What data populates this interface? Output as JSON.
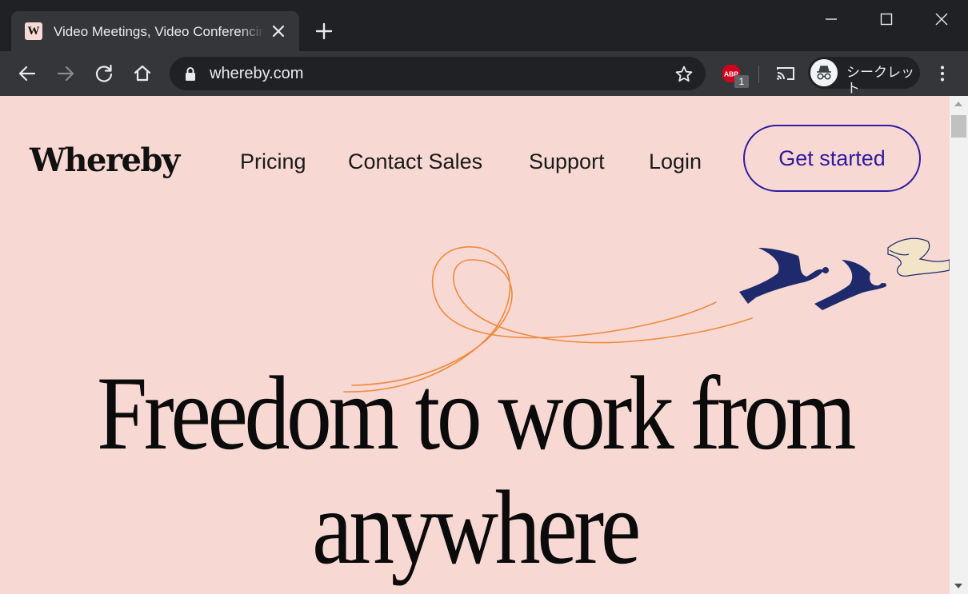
{
  "browser": {
    "tab_title": "Video Meetings, Video Conferencing",
    "tab_favicon_letter": "W",
    "url": "whereby.com",
    "adblock_label": "ABP",
    "adblock_count": "1",
    "profile_label": "シークレット"
  },
  "site": {
    "logo": "Whereby",
    "nav": {
      "pricing": "Pricing",
      "contact_sales": "Contact Sales",
      "support": "Support",
      "login": "Login"
    },
    "cta": "Get started",
    "hero": {
      "line1": "Freedom to work from",
      "line2": "anywhere"
    }
  },
  "colors": {
    "page_background": "#f8d8d3",
    "accent": "#2f1c9f",
    "illustration_orange": "#f08a3c",
    "illustration_navy": "#1e2a6b"
  }
}
